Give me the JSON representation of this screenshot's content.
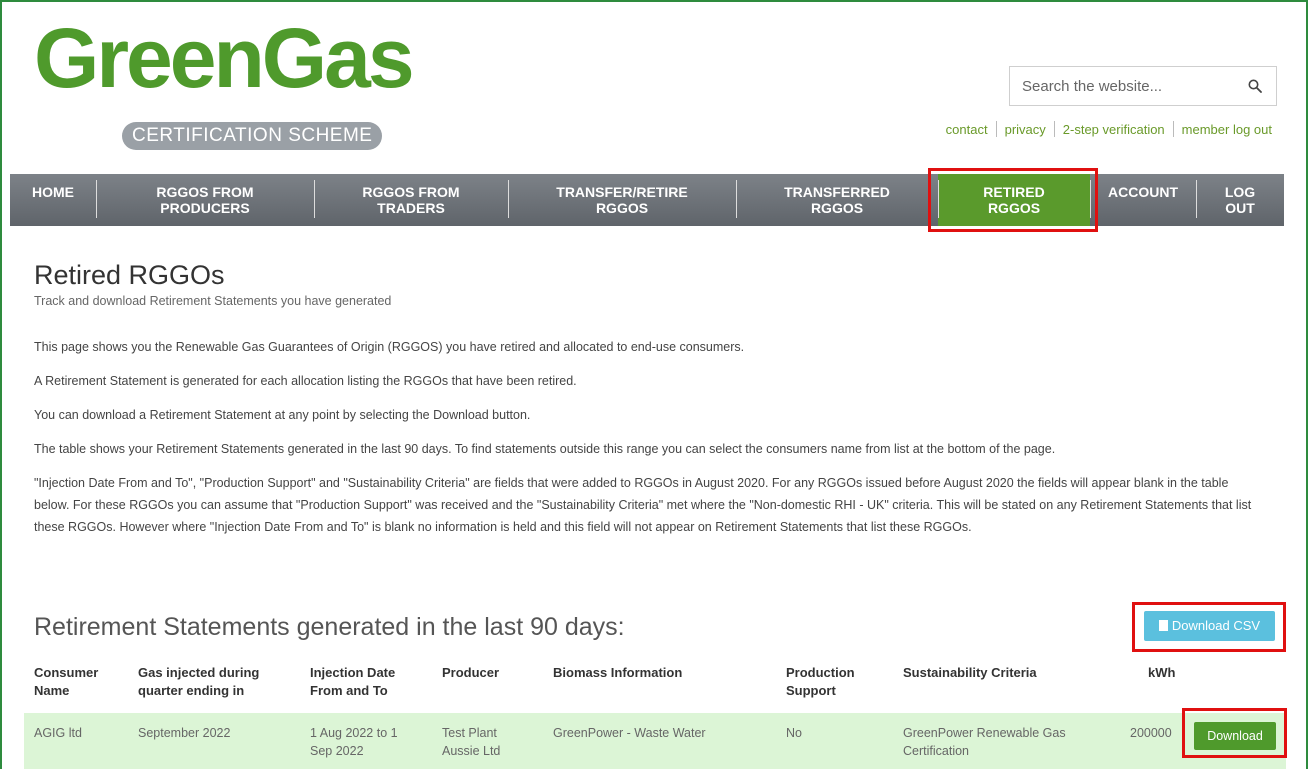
{
  "brand": {
    "name": "GreenGas",
    "tagline": "CERTIFICATION SCHEME"
  },
  "search": {
    "placeholder": "Search the website..."
  },
  "toplinks": [
    "contact",
    "privacy",
    "2-step verification",
    "member log out"
  ],
  "nav": [
    {
      "label": "HOME"
    },
    {
      "label": "RGGOS FROM\nPRODUCERS"
    },
    {
      "label": "RGGOS FROM\nTRADERS"
    },
    {
      "label": "TRANSFER/RETIRE\nRGGOS"
    },
    {
      "label": "TRANSFERRED\nRGGOS"
    },
    {
      "label": "RETIRED\nRGGOS",
      "active": true
    },
    {
      "label": "ACCOUNT"
    },
    {
      "label": "LOG\nOUT"
    }
  ],
  "page": {
    "title": "Retired RGGOs",
    "subtitle": "Track and download Retirement Statements you have generated",
    "paragraphs": [
      "This page shows you the Renewable Gas Guarantees of Origin (RGGOS) you have retired and allocated to end-use consumers.",
      "A Retirement Statement is generated for each allocation listing the RGGOs that have been retired.",
      "You can download a Retirement Statement at any point by selecting the Download button.",
      "The table shows your Retirement Statements generated in the last 90 days. To find statements outside this range you can select the consumers name from list at the bottom of the page.",
      "\"Injection Date From and To\", \"Production Support\" and \"Sustainability Criteria\" are fields that were added to RGGOs in August 2020. For any RGGOs issued before August 2020 the fields will appear blank in the table below. For these RGGOs you can assume that \"Production Support\" was received and the \"Sustainability Criteria\" met where the \"Non-domestic RHI - UK\" criteria. This will be stated on any Retirement Statements that list these RGGOs. However where \"Injection Date From and To\" is blank no information is held and this field will not appear on Retirement Statements that list these RGGOs."
    ]
  },
  "statements": {
    "heading": "Retirement Statements generated in the last 90 days:",
    "csv_label": "Download CSV",
    "columns": [
      "Consumer Name",
      "Gas injected during quarter ending in",
      "Injection Date From and To",
      "Producer",
      "Biomass Information",
      "Production Support",
      "Sustainability Criteria",
      "kWh"
    ],
    "rows": [
      {
        "consumer": "AGIG ltd",
        "quarter": "September 2022",
        "injection": "1 Aug 2022 to 1 Sep 2022",
        "producer": "Test Plant Aussie Ltd",
        "biomass": "GreenPower - Waste Water",
        "support": "No",
        "criteria": "GreenPower Renewable Gas Certification",
        "kwh": "200000",
        "action": "Download"
      }
    ]
  },
  "colors": {
    "brand_green": "#4f9a2c",
    "nav_gray": "#6b7075",
    "row_green": "#dcf5d6",
    "csv_blue": "#5bc0de",
    "highlight_red": "#e01010"
  }
}
